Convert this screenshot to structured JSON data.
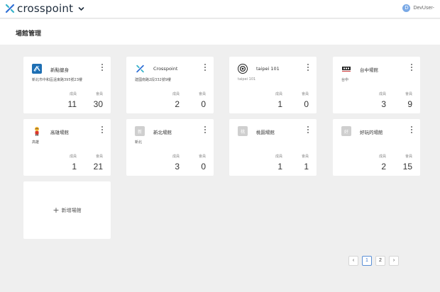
{
  "app": {
    "brand_name": "crosspoint",
    "user_initial": "D",
    "user_name": "DevUser-"
  },
  "page": {
    "title": "場館管理"
  },
  "card_labels": {
    "members": "成員",
    "customers": "會員"
  },
  "gyms": [
    {
      "name": "新點健身",
      "address": "新北市中和區遠東路395號23樓",
      "members": "11",
      "customers": "30",
      "logo": "xinian-logo"
    },
    {
      "name": "Crosspoint",
      "address": "建國南路2段332號9樓",
      "members": "2",
      "customers": "0",
      "logo": "crosspoint-logo"
    },
    {
      "name": "taipei 101",
      "address": "taipei 101",
      "members": "1",
      "customers": "0",
      "logo": "camera-lens-logo"
    },
    {
      "name": "台中場館",
      "address": "台中",
      "members": "3",
      "customers": "9",
      "logo": "taichung-logo"
    },
    {
      "name": "高雄場館",
      "address": "高雄",
      "members": "1",
      "customers": "21",
      "logo": "mascot-logo"
    },
    {
      "name": "新北場館",
      "address": "新北",
      "members": "3",
      "customers": "0",
      "logo": "placeholder-logo",
      "initial": "新"
    },
    {
      "name": "桃園場館",
      "address": "",
      "members": "1",
      "customers": "1",
      "logo": "placeholder-logo",
      "initial": "桃"
    },
    {
      "name": "好玩的場館",
      "address": "",
      "members": "2",
      "customers": "15",
      "logo": "placeholder-logo",
      "initial": "好"
    }
  ],
  "add_card": {
    "plus": "+",
    "label": "新增場館"
  },
  "pagination": {
    "prev": "‹",
    "pages": [
      "1",
      "2"
    ],
    "active_page": "1",
    "next": "›"
  },
  "colors": {
    "brand_blue": "#2f6fd6",
    "brand_teal": "#36b3c9",
    "active_border": "#5a8fd6",
    "background": "#efefef"
  }
}
